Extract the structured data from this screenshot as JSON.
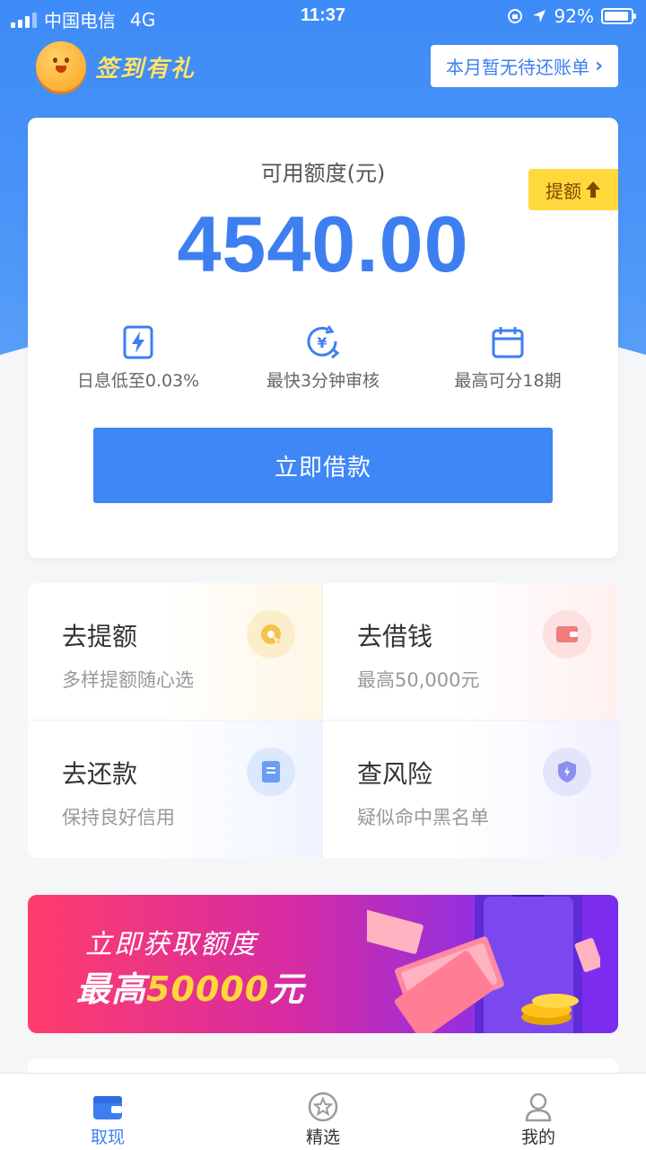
{
  "status_bar": {
    "carrier": "中国电信",
    "network": "4G",
    "time": "11:37",
    "battery": "92%"
  },
  "header": {
    "checkin_label": "签到有礼",
    "bill_button": "本月暂无待还账单"
  },
  "quota_card": {
    "label": "可用额度(元)",
    "value": "4540.00",
    "raise_button": "提额",
    "features": [
      {
        "icon": "lightning-icon",
        "text": "日息低至0.03%"
      },
      {
        "icon": "yuan-refresh-icon",
        "text": "最快3分钟审核"
      },
      {
        "icon": "calendar-icon",
        "text": "最高可分18期"
      }
    ],
    "borrow_button": "立即借款"
  },
  "services": [
    {
      "title": "去提额",
      "subtitle": "多样提额随心选",
      "icon": "quota-disc-icon",
      "color": "#f5c24a"
    },
    {
      "title": "去借钱",
      "subtitle": "最高50,000元",
      "icon": "wallet-icon",
      "color": "#f27b7b"
    },
    {
      "title": "去还款",
      "subtitle": "保持良好信用",
      "icon": "bill-icon",
      "color": "#6b9df5"
    },
    {
      "title": "查风险",
      "subtitle": "疑似命中黑名单",
      "icon": "shield-icon",
      "color": "#8d8ff0"
    }
  ],
  "banner": {
    "line1": "立即获取额度",
    "line2_prefix": "最高",
    "line2_amount": "50000",
    "line2_suffix": "元"
  },
  "tabbar": {
    "tabs": [
      {
        "label": "取现",
        "icon": "wallet-tab-icon",
        "active": true
      },
      {
        "label": "精选",
        "icon": "star-tab-icon",
        "active": false
      },
      {
        "label": "我的",
        "icon": "user-tab-icon",
        "active": false
      }
    ]
  },
  "colors": {
    "brand_blue": "#3d7ff0",
    "raise_yellow": "#ffd83b"
  }
}
